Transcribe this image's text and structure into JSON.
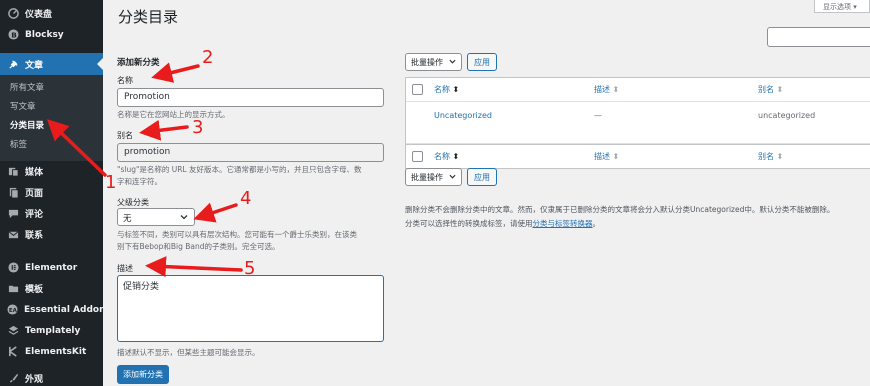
{
  "sidebar": {
    "items": [
      {
        "label": "仪表盘",
        "icon": "dashboard-icon"
      },
      {
        "label": "Blocksy",
        "icon": "blocksy-icon"
      },
      {
        "label": "文章",
        "icon": "pin-icon"
      },
      {
        "label": "媒体",
        "icon": "media-icon"
      },
      {
        "label": "页面",
        "icon": "page-icon"
      },
      {
        "label": "评论",
        "icon": "comment-icon"
      },
      {
        "label": "联系",
        "icon": "mail-icon"
      },
      {
        "label": "Elementor",
        "icon": "elementor-icon"
      },
      {
        "label": "模板",
        "icon": "folder-icon"
      },
      {
        "label": "Essential Addons",
        "icon": "ea-icon"
      },
      {
        "label": "Templately",
        "icon": "templately-icon"
      },
      {
        "label": "ElementsKit",
        "icon": "elementskit-icon"
      },
      {
        "label": "外观",
        "icon": "brush-icon"
      }
    ],
    "submenu": [
      "所有文章",
      "写文章",
      "分类目录",
      "标签"
    ]
  },
  "header": {
    "title": "分类目录",
    "screen_options": "显示选项 ▾"
  },
  "form": {
    "heading": "添加新分类",
    "name_label": "名称",
    "name_value": "Promotion",
    "name_desc": "名称是它在您网站上的显示方式。",
    "slug_label": "别名",
    "slug_value": "promotion",
    "slug_desc_1": "\"slug\"是名称的 URL 友好版本。它通常都是小写的，并且只包含字母、数",
    "slug_desc_2": "字和连字符。",
    "parent_label": "父级分类",
    "parent_value": "无",
    "parent_desc_1": "与标签不同，类别可以具有层次结构。您可能有一个爵士乐类别，在该类",
    "parent_desc_2": "别下有Bebop和Big Band的子类别。完全可选。",
    "desc_label": "描述",
    "desc_value": "促销分类",
    "desc_help": "描述默认不显示，但某些主题可能会显示。",
    "submit": "添加新分类"
  },
  "table": {
    "bulk_label": "批量操作",
    "apply_label": "应用",
    "columns": [
      "名称",
      "描述",
      "别名"
    ],
    "rows": [
      {
        "name": "Uncategorized",
        "description": "—",
        "slug": "uncategorized"
      }
    ]
  },
  "notes": {
    "line1": "删除分类不会删除分类中的文章。然而，仅隶属于已删除分类的文章将会分入默认分类Uncategorized中。默认分类不能被删除。",
    "line2_prefix": "分类可以选择性的转换成标签，请使用",
    "line2_link": "分类与标签转换器",
    "line2_suffix": "。"
  },
  "annotations": [
    "1",
    "2",
    "3",
    "4",
    "5"
  ],
  "colors": {
    "sidebar_bg": "#1d2327",
    "accent": "#2271b1",
    "annotation": "#e81c1c"
  }
}
